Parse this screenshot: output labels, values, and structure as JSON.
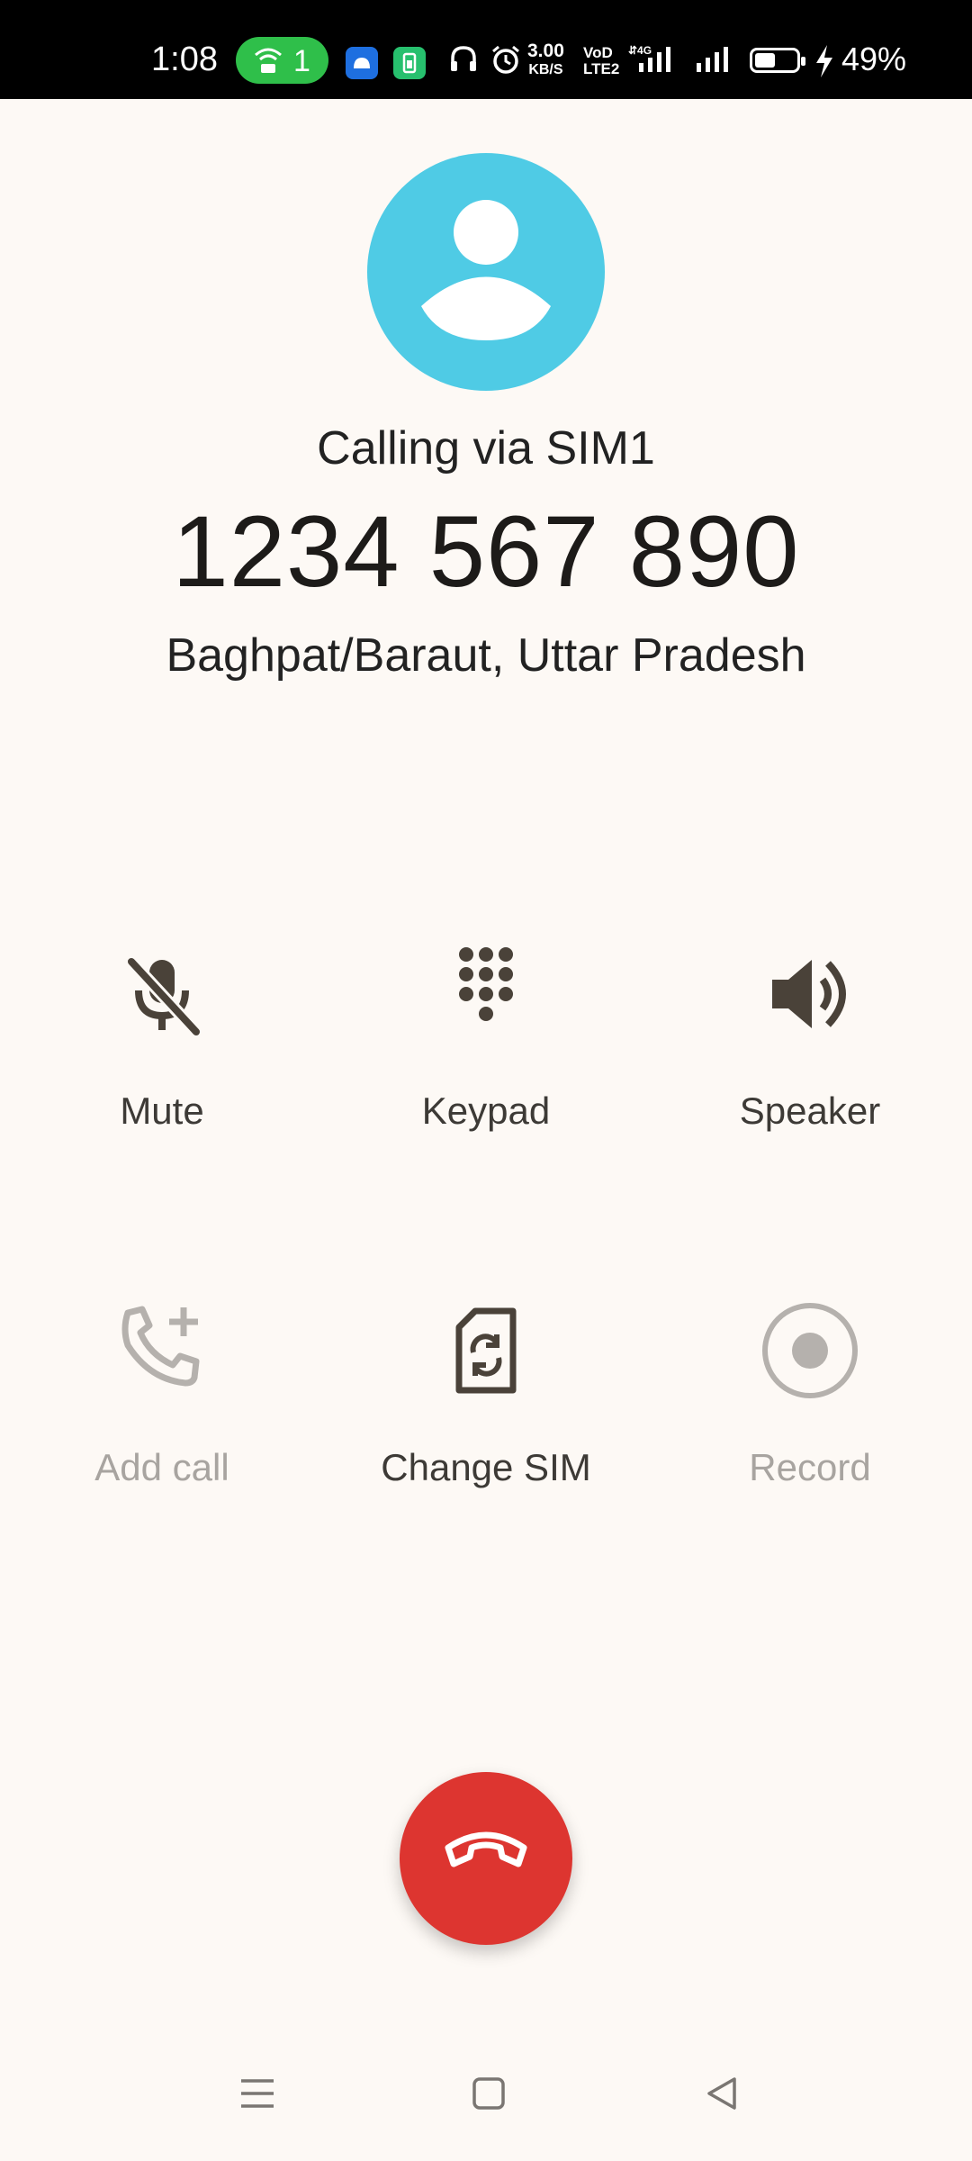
{
  "status_bar": {
    "time": "1:08",
    "hotspot_count": "1",
    "net_speed_value": "3.00",
    "net_speed_unit": "KB/S",
    "volte_line1": "VoD",
    "volte_line2": "LTE2",
    "battery_percent": "49%",
    "icons": [
      "hotspot-icon",
      "android-app-icon",
      "battery-app-icon",
      "headphones-icon",
      "alarm-icon",
      "signal-sim1-icon",
      "signal-sim2-icon",
      "battery-icon",
      "charging-icon"
    ]
  },
  "call": {
    "calling_via": "Calling via SIM1",
    "number": "1234 567 890",
    "location": "Baghpat/Baraut, Uttar Pradesh"
  },
  "controls": {
    "mute": "Mute",
    "keypad": "Keypad",
    "speaker": "Speaker",
    "add_call": "Add call",
    "change_sim": "Change SIM",
    "record": "Record"
  },
  "colors": {
    "background": "#fdf9f5",
    "avatar": "#4fcbe5",
    "end_call": "#dd3530",
    "icon": "#4a4239",
    "disabled": "#b5b1ad",
    "hotspot_pill": "#2fbf4a"
  },
  "nav": {
    "icons": [
      "menu-icon",
      "home-icon",
      "back-icon"
    ]
  }
}
